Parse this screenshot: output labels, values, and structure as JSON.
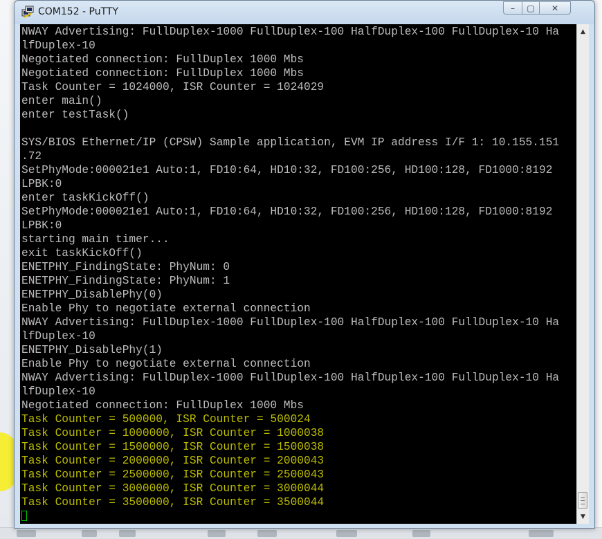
{
  "window": {
    "title": "COM152 - PuTTY",
    "icon": "putty-terminal-icon"
  },
  "caption_buttons": {
    "minimize": "–",
    "maximize": "▢",
    "close": "✕"
  },
  "terminal": {
    "background": "#000000",
    "default_color": "#bbbbbb",
    "highlight_color": "#bbbb00",
    "cursor_color": "#00d000",
    "lines": [
      {
        "text": "NWAY Advertising: FullDuplex-1000 FullDuplex-100 HalfDuplex-100 FullDuplex-10 Ha",
        "color": "default"
      },
      {
        "text": "lfDuplex-10",
        "color": "default"
      },
      {
        "text": "Negotiated connection: FullDuplex 1000 Mbs",
        "color": "default"
      },
      {
        "text": "Negotiated connection: FullDuplex 1000 Mbs",
        "color": "default"
      },
      {
        "text": "Task Counter = 1024000, ISR Counter = 1024029",
        "color": "default"
      },
      {
        "text": "enter main()",
        "color": "default"
      },
      {
        "text": "enter testTask()",
        "color": "default"
      },
      {
        "text": "",
        "color": "default"
      },
      {
        "text": "SYS/BIOS Ethernet/IP (CPSW) Sample application, EVM IP address I/F 1: 10.155.151",
        "color": "default"
      },
      {
        "text": ".72",
        "color": "default"
      },
      {
        "text": "SetPhyMode:000021e1 Auto:1, FD10:64, HD10:32, FD100:256, HD100:128, FD1000:8192",
        "color": "default"
      },
      {
        "text": "LPBK:0",
        "color": "default"
      },
      {
        "text": "enter taskKickOff()",
        "color": "default"
      },
      {
        "text": "SetPhyMode:000021e1 Auto:1, FD10:64, HD10:32, FD100:256, HD100:128, FD1000:8192",
        "color": "default"
      },
      {
        "text": "LPBK:0",
        "color": "default"
      },
      {
        "text": "starting main timer...",
        "color": "default"
      },
      {
        "text": "exit taskKickOff()",
        "color": "default"
      },
      {
        "text": "ENETPHY_FindingState: PhyNum: 0",
        "color": "default"
      },
      {
        "text": "ENETPHY_FindingState: PhyNum: 1",
        "color": "default"
      },
      {
        "text": "ENETPHY_DisablePhy(0)",
        "color": "default"
      },
      {
        "text": "Enable Phy to negotiate external connection",
        "color": "default"
      },
      {
        "text": "NWAY Advertising: FullDuplex-1000 FullDuplex-100 HalfDuplex-100 FullDuplex-10 Ha",
        "color": "default"
      },
      {
        "text": "lfDuplex-10",
        "color": "default"
      },
      {
        "text": "ENETPHY_DisablePhy(1)",
        "color": "default"
      },
      {
        "text": "Enable Phy to negotiate external connection",
        "color": "default"
      },
      {
        "text": "NWAY Advertising: FullDuplex-1000 FullDuplex-100 HalfDuplex-100 FullDuplex-10 Ha",
        "color": "default"
      },
      {
        "text": "lfDuplex-10",
        "color": "default"
      },
      {
        "text": "Negotiated connection: FullDuplex 1000 Mbs",
        "color": "default"
      },
      {
        "text": "Task Counter = 500000, ISR Counter = 500024",
        "color": "highlight"
      },
      {
        "text": "Task Counter = 1000000, ISR Counter = 1000038",
        "color": "highlight"
      },
      {
        "text": "Task Counter = 1500000, ISR Counter = 1500038",
        "color": "highlight"
      },
      {
        "text": "Task Counter = 2000000, ISR Counter = 2000043",
        "color": "highlight"
      },
      {
        "text": "Task Counter = 2500000, ISR Counter = 2500043",
        "color": "highlight"
      },
      {
        "text": "Task Counter = 3000000, ISR Counter = 3000044",
        "color": "highlight"
      },
      {
        "text": "Task Counter = 3500000, ISR Counter = 3500044",
        "color": "highlight"
      }
    ]
  },
  "scrollbar": {
    "up_arrow": "▲",
    "down_arrow": "▼",
    "position": 1.0
  }
}
